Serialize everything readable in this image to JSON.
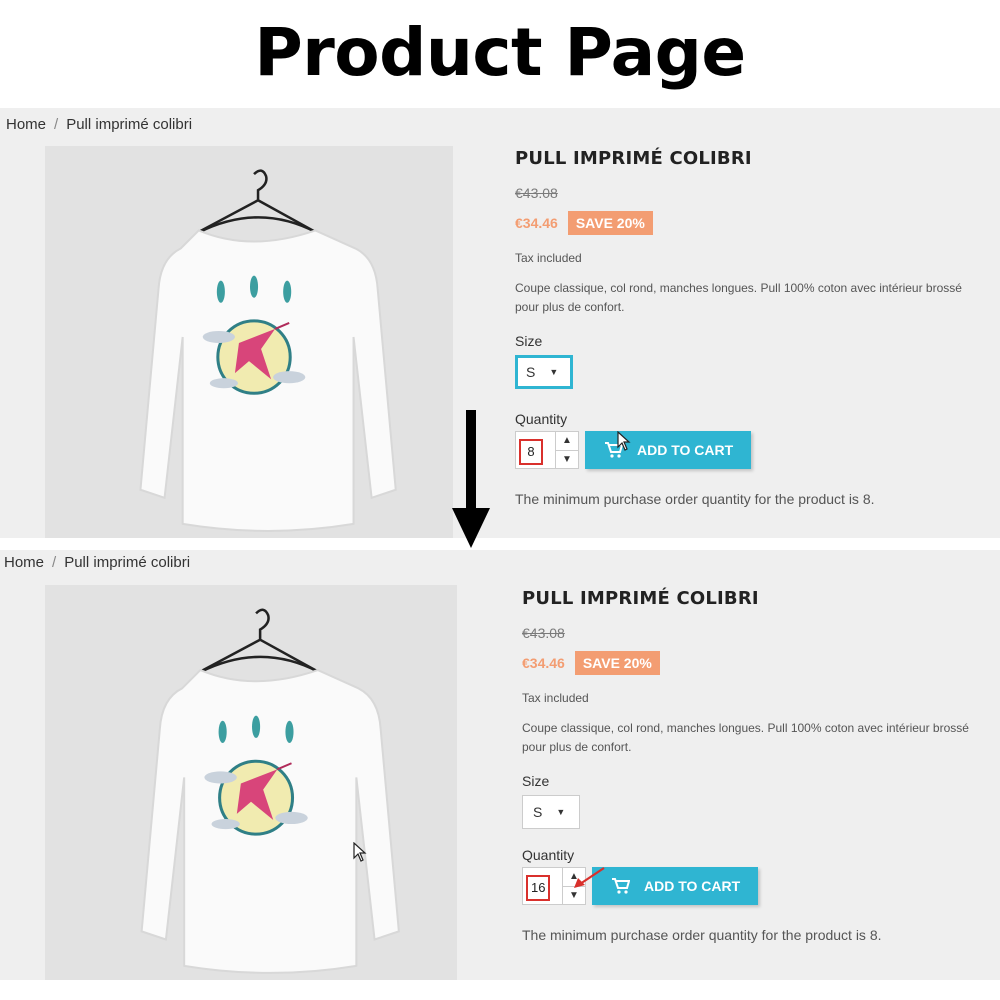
{
  "page": {
    "title": "Product Page"
  },
  "panels": [
    {
      "breadcrumb": {
        "home": "Home",
        "separator": "/",
        "current": "Pull imprimé colibri"
      },
      "product": {
        "name": "PULL IMPRIMÉ COLIBRI",
        "old_price": "€43.08",
        "new_price": "€34.46",
        "discount_badge": "SAVE 20%",
        "tax_note": "Tax included",
        "description": "Coupe classique, col rond, manches longues. Pull 100% coton avec intérieur brossé pour plus de confort."
      },
      "size": {
        "label": "Size",
        "selected": "S"
      },
      "quantity": {
        "label": "Quantity",
        "value": "8"
      },
      "cart": {
        "button_label": "ADD TO CART"
      },
      "note": "The minimum purchase order quantity for the product is 8."
    },
    {
      "breadcrumb": {
        "home": "Home",
        "separator": "/",
        "current": "Pull imprimé colibri"
      },
      "product": {
        "name": "PULL IMPRIMÉ COLIBRI",
        "old_price": "€43.08",
        "new_price": "€34.46",
        "discount_badge": "SAVE 20%",
        "tax_note": "Tax included",
        "description": "Coupe classique, col rond, manches longues. Pull 100% coton avec intérieur brossé pour plus de confort."
      },
      "size": {
        "label": "Size",
        "selected": "S"
      },
      "quantity": {
        "label": "Quantity",
        "value": "16"
      },
      "cart": {
        "button_label": "ADD TO CART"
      },
      "note": "The minimum purchase order quantity for the product is 8."
    }
  ],
  "colors": {
    "accent": "#2fb5d2",
    "discount": "#f39d72",
    "highlight": "#d9302c",
    "panel_bg": "#efefef"
  },
  "icons": [
    "cart-icon",
    "caret-down-icon",
    "arrow-down-icon",
    "mouse-cursor-icon",
    "red-pointer-arrow-icon"
  ]
}
